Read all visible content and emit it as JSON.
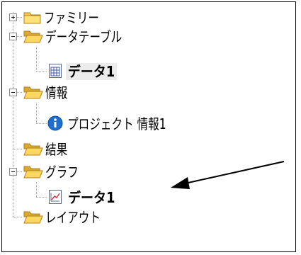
{
  "tree": {
    "nodes": [
      {
        "label": "ファミリー",
        "icon": "folder-closed-icon",
        "toggle": "plus",
        "bold": false
      },
      {
        "label": "データテーブル",
        "icon": "folder-open-icon",
        "toggle": "minus",
        "bold": false
      },
      {
        "label": "データ1",
        "icon": "table-icon",
        "toggle": null,
        "bold": true,
        "selected": true
      },
      {
        "label": "情報",
        "icon": "folder-open-icon",
        "toggle": "minus",
        "bold": false
      },
      {
        "label": "プロジェクト 情報1",
        "icon": "info-icon",
        "toggle": null,
        "bold": false
      },
      {
        "label": "結果",
        "icon": "folder-open-icon",
        "toggle": null,
        "bold": false
      },
      {
        "label": "グラフ",
        "icon": "folder-open-icon",
        "toggle": "minus",
        "bold": false
      },
      {
        "label": "データ1",
        "icon": "chart-icon",
        "toggle": null,
        "bold": true
      },
      {
        "label": "レイアウト",
        "icon": "folder-open-icon",
        "toggle": null,
        "bold": false
      }
    ]
  },
  "colors": {
    "folder": "#f2c94c",
    "folder_dark": "#c7961e",
    "info": "#1c6fd1",
    "arrow": "#000000"
  }
}
